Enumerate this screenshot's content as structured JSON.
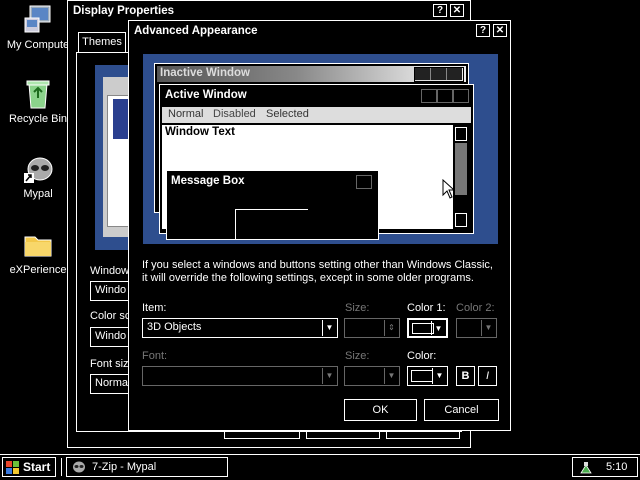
{
  "desktop": {
    "icons": [
      {
        "label": "My Compute",
        "icon": "computer-icon"
      },
      {
        "label": "Recycle Bin",
        "icon": "recycle-bin-icon"
      },
      {
        "label": "Mypal",
        "icon": "raccoon-shortcut-icon"
      },
      {
        "label": "eXPerience",
        "icon": "folder-icon"
      }
    ]
  },
  "display_properties": {
    "title": "Display Properties",
    "help_btn": "?",
    "close_btn": "✕",
    "tab_themes": "Themes",
    "partial_labels": {
      "window_label": "Window",
      "window_value": "Windo",
      "color_label": "Color sc",
      "color_value": "Windo",
      "font_label": "Font size",
      "font_value": "Normal"
    }
  },
  "advanced_appearance": {
    "title": "Advanced Appearance",
    "help_btn": "?",
    "close_btn": "✕",
    "preview": {
      "inactive_title": "Inactive Window",
      "active_title": "Active Window",
      "menu": [
        "Normal",
        "Disabled",
        "Selected"
      ],
      "window_text": "Window Text",
      "message_box_title": "Message Box"
    },
    "info_text_1": "If you select a windows and buttons setting other than Windows Classic,",
    "info_text_2": "it will override the following settings, except in some older programs.",
    "item_label": "Item:",
    "item_value": "3D Objects",
    "size_label_1": "Size:",
    "color1_label": "Color 1:",
    "color2_label": "Color 2:",
    "font_label": "Font:",
    "size_label_2": "Size:",
    "color_label": "Color:",
    "bold_btn": "B",
    "italic_btn": "I",
    "ok": "OK",
    "cancel": "Cancel",
    "colors": {
      "accent": "#2e4e8e",
      "swatch": "#000000"
    }
  },
  "taskbar": {
    "start": "Start",
    "task_item": "7-Zip - Mypal",
    "clock": "5:10"
  }
}
